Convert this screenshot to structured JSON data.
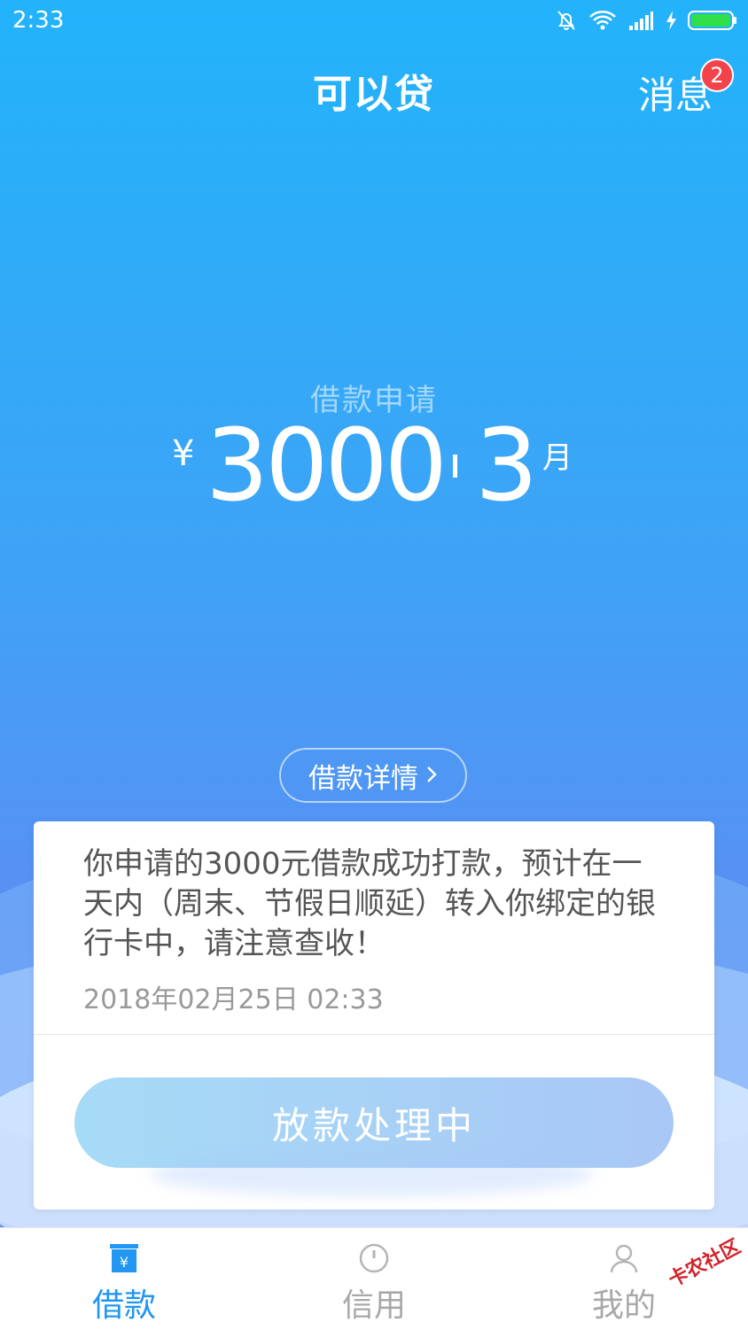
{
  "status_bar": {
    "time": "2:33"
  },
  "header": {
    "title": "可以贷",
    "messages_label": "消息",
    "unread_count": "2"
  },
  "loan": {
    "apply_label": "借款申请",
    "currency": "¥",
    "amount": "3000",
    "term": "3",
    "term_unit": "月",
    "details_button": "借款详情"
  },
  "card": {
    "notice": "你申请的3000元借款成功打款，预计在一天内（周末、节假日顺延）转入你绑定的银行卡中，请注意查收！",
    "timestamp": "2018年02月25日 02:33",
    "status_button": "放款处理中"
  },
  "tabs": [
    {
      "label": "借款",
      "icon": "loan-icon",
      "active": true
    },
    {
      "label": "信用",
      "icon": "credit-gauge-icon",
      "active": false
    },
    {
      "label": "我的",
      "icon": "user-icon",
      "active": false
    }
  ],
  "watermark": "卡农社区",
  "colors": {
    "accent": "#2196f3",
    "badge": "#f2434b",
    "hero_top": "#22b3fb",
    "hero_bottom": "#6a8cf0"
  }
}
